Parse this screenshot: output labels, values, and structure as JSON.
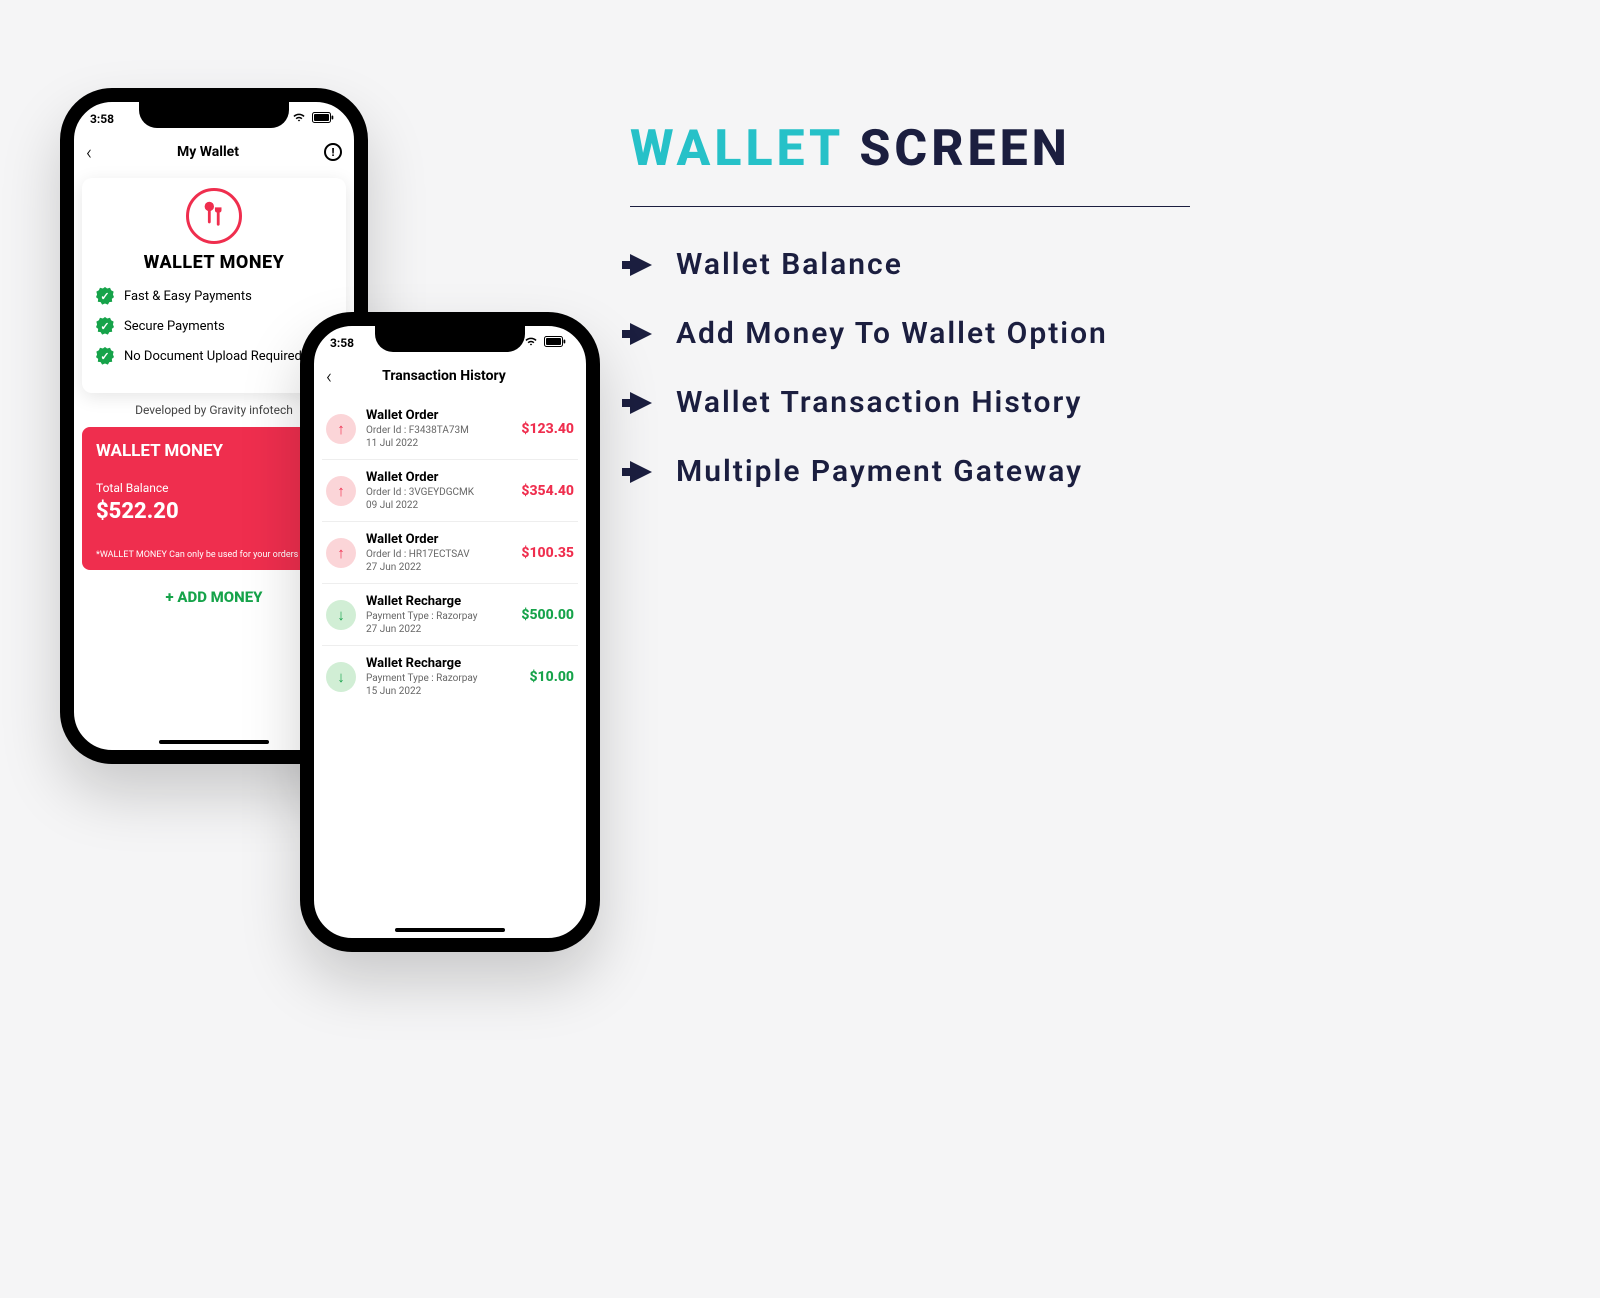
{
  "heading": {
    "accent": "WALLET",
    "rest": "SCREEN"
  },
  "features": [
    "Wallet Balance",
    "Add Money To Wallet Option",
    "Wallet Transaction History",
    "Multiple Payment Gateway"
  ],
  "phoneA": {
    "time": "3:58",
    "nav_title": "My Wallet",
    "card_title": "WALLET MONEY",
    "bullets": [
      "Fast & Easy Payments",
      "Secure Payments",
      "No Document Upload Required"
    ],
    "developed_by": "Developed by Gravity infotech",
    "balance": {
      "label": "WALLET MONEY",
      "total_label": "Total Balance",
      "amount": "$522.20",
      "note": "*WALLET MONEY Can only be used for your orders"
    },
    "add_money": "+ ADD MONEY"
  },
  "phoneB": {
    "time": "3:58",
    "nav_title": "Transaction History",
    "transactions": [
      {
        "direction": "up",
        "title": "Wallet Order",
        "sub": "Order Id : F3438TA73M",
        "date": "11 Jul 2022",
        "amount": "$123.40",
        "kind": "debit"
      },
      {
        "direction": "up",
        "title": "Wallet Order",
        "sub": "Order Id : 3VGEYDGCMK",
        "date": "09 Jul 2022",
        "amount": "$354.40",
        "kind": "debit"
      },
      {
        "direction": "up",
        "title": "Wallet Order",
        "sub": "Order Id : HR17ECTSAV",
        "date": "27 Jun 2022",
        "amount": "$100.35",
        "kind": "debit"
      },
      {
        "direction": "down",
        "title": "Wallet Recharge",
        "sub": "Payment Type : Razorpay",
        "date": "27 Jun 2022",
        "amount": "$500.00",
        "kind": "credit"
      },
      {
        "direction": "down",
        "title": "Wallet Recharge",
        "sub": "Payment Type : Razorpay",
        "date": "15 Jun 2022",
        "amount": "$10.00",
        "kind": "credit"
      }
    ]
  }
}
